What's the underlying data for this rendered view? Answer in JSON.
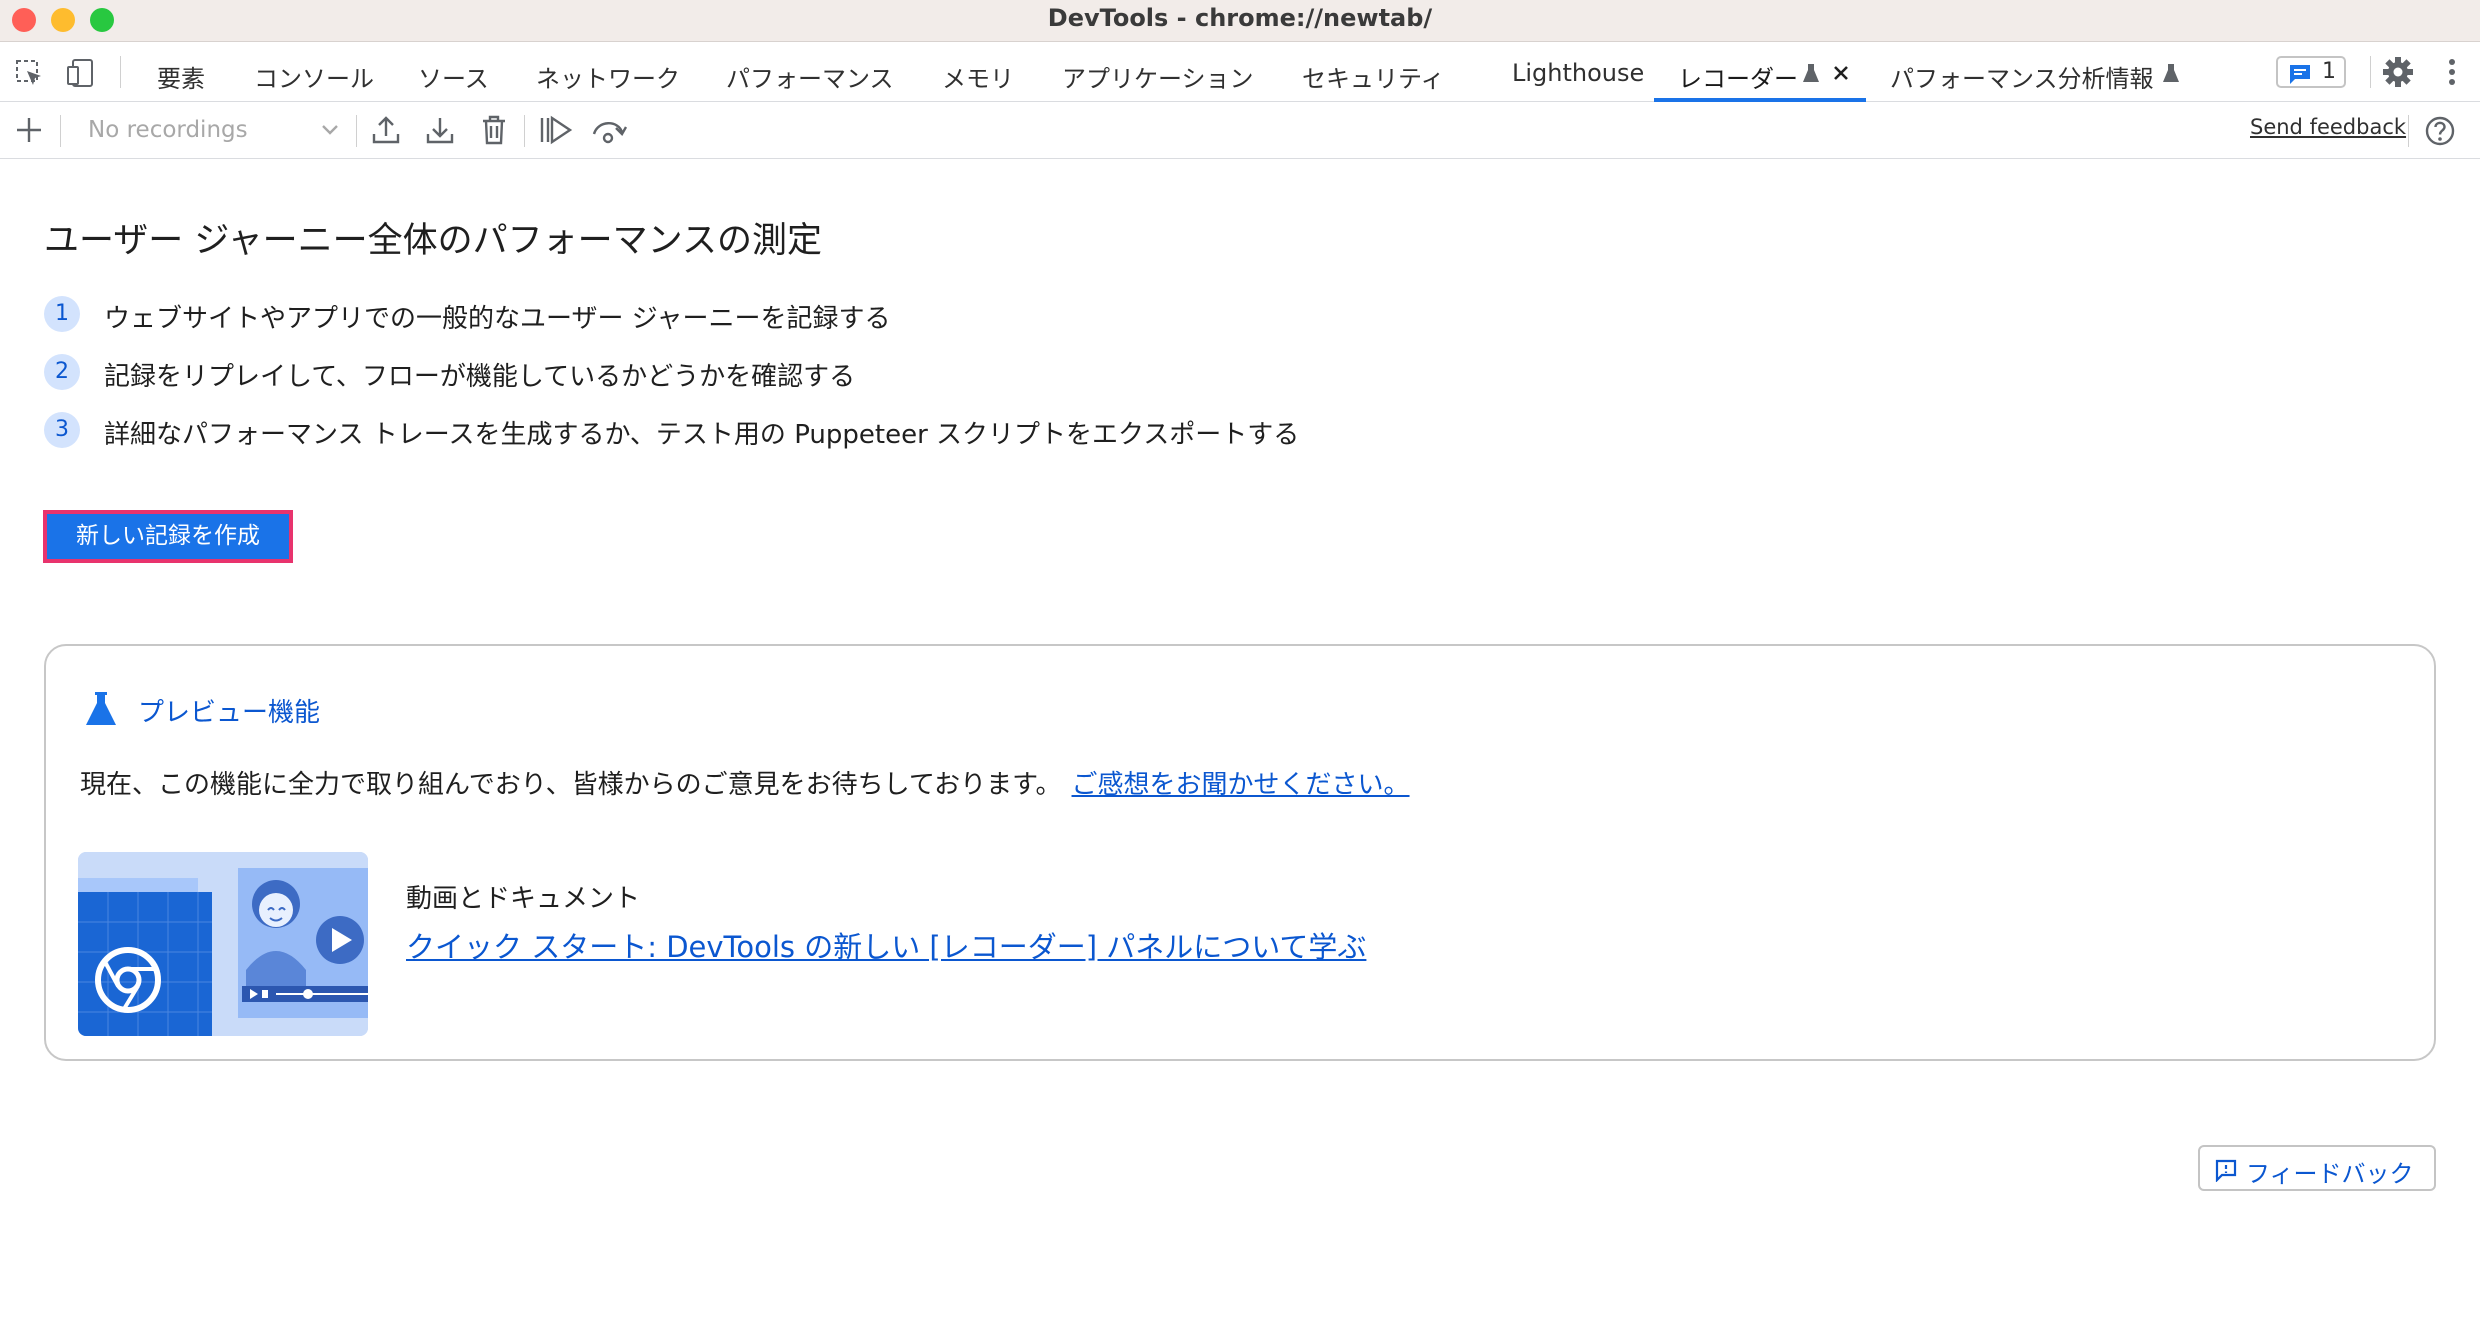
{
  "window": {
    "title": "DevTools - chrome://newtab/"
  },
  "tabs": [
    {
      "label": "要素",
      "active": false
    },
    {
      "label": "コンソール",
      "active": false
    },
    {
      "label": "ソース",
      "active": false
    },
    {
      "label": "ネットワーク",
      "active": false
    },
    {
      "label": "パフォーマンス",
      "active": false
    },
    {
      "label": "メモリ",
      "active": false
    },
    {
      "label": "アプリケーション",
      "active": false
    },
    {
      "label": "セキュリティ",
      "active": false
    },
    {
      "label": "Lighthouse",
      "active": false
    },
    {
      "label": "レコーダー",
      "active": true,
      "icon": "flask-icon",
      "closable": true
    },
    {
      "label": "パフォーマンス分析情報",
      "active": false,
      "icon": "flask-icon"
    }
  ],
  "issues": {
    "count": "1",
    "icon": "issue-message-icon"
  },
  "toolbar": {
    "recording_select_placeholder": "No recordings",
    "send_feedback": "Send feedback"
  },
  "main": {
    "headline": "ユーザー ジャーニー全体のパフォーマンスの測定",
    "steps": [
      {
        "num": "1",
        "text": "ウェブサイトやアプリでの一般的なユーザー ジャーニーを記録する"
      },
      {
        "num": "2",
        "text": "記録をリプレイして、フローが機能しているかどうかを確認する"
      },
      {
        "num": "3",
        "text": "詳細なパフォーマンス トレースを生成するか、テスト用の Puppeteer スクリプトをエクスポートする"
      }
    ],
    "create_button": "新しい記録を作成"
  },
  "preview_card": {
    "title": "プレビュー機能",
    "description": "現在、この機能に全力で取り組んでおり、皆様からのご意見をお待ちしております。",
    "feedback_link": "ご感想をお聞かせください。",
    "media_label": "動画とドキュメント",
    "media_link": "クイック スタート: DevTools の新しい [レコーダー] パネルについて学ぶ"
  },
  "footer": {
    "feedback_button": "フィードバック"
  },
  "colors": {
    "accent": "#1a73e8",
    "link": "#0b57d0",
    "highlight_border": "#e8336d",
    "step_badge_bg": "#d3e3fd"
  }
}
